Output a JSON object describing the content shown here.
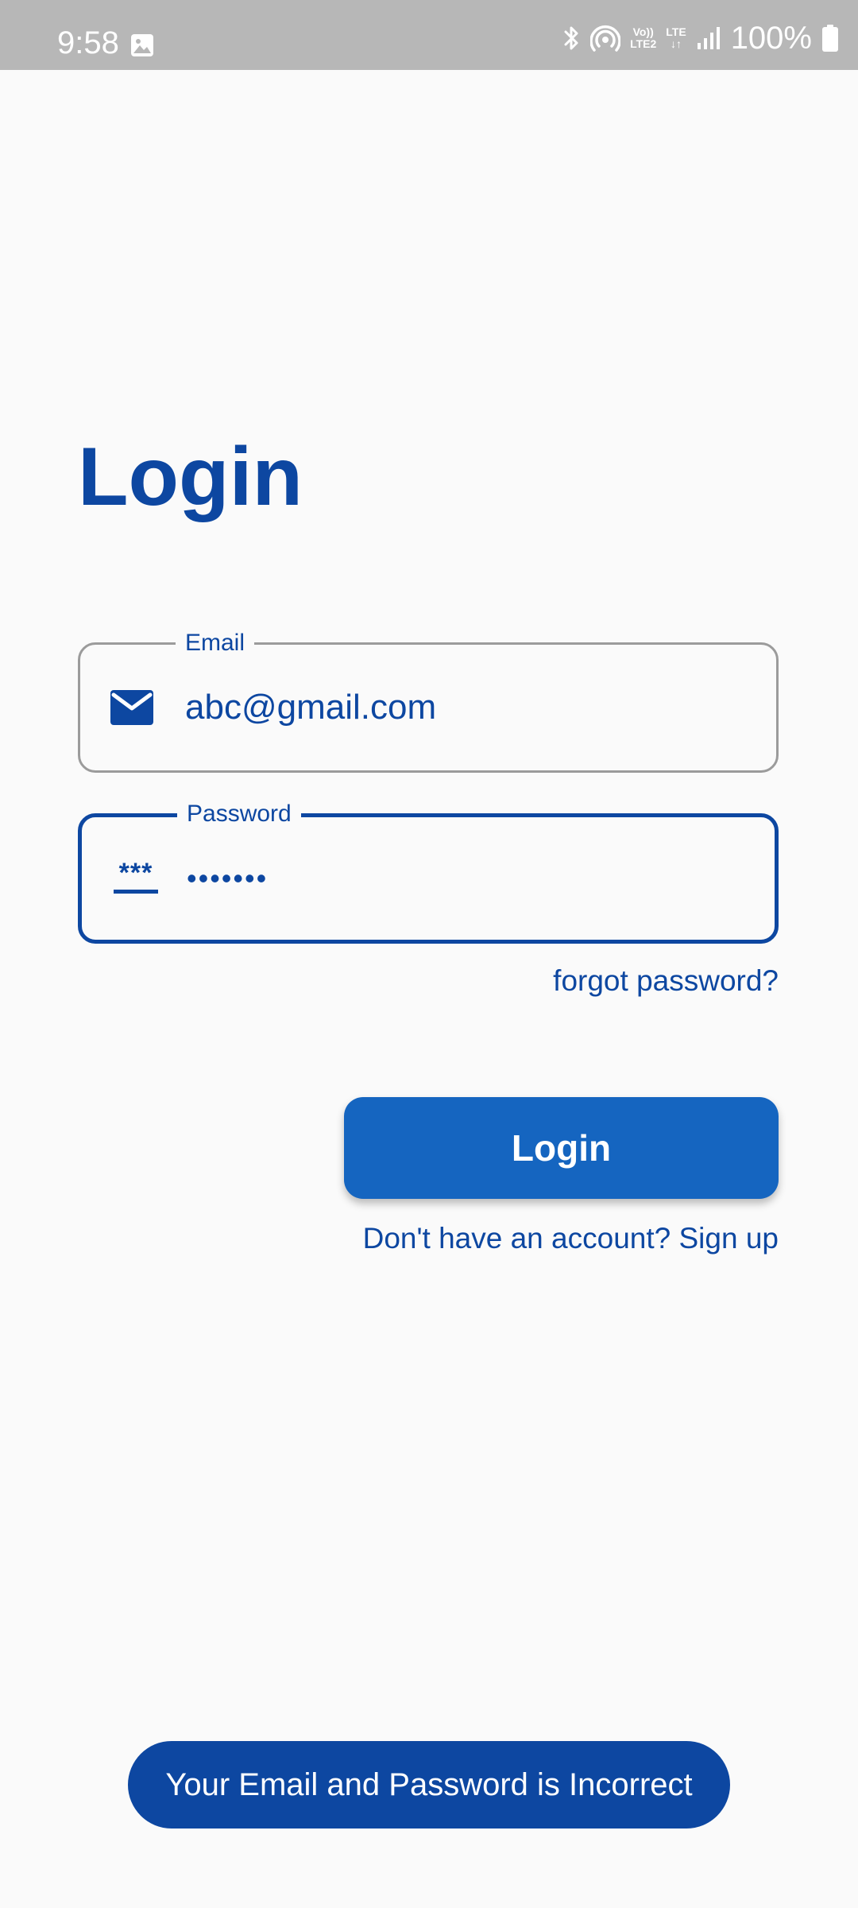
{
  "status_bar": {
    "time": "9:58",
    "volte_top": "Vo))",
    "volte_bottom": "LTE2",
    "lte_label": "LTE",
    "lte_arrows": "↓↑",
    "battery": "100%",
    "icons": [
      "gallery-icon",
      "bluetooth-icon",
      "hotspot-icon",
      "signal-icon",
      "battery-icon"
    ]
  },
  "login": {
    "title": "Login",
    "email": {
      "label": "Email",
      "value": "abc@gmail.com",
      "icon": "mail-icon"
    },
    "password": {
      "label": "Password",
      "value": "•••••••",
      "icon": "password-asterisk-icon"
    },
    "forgot_password": "forgot password?",
    "login_button": "Login",
    "signup_prompt": "Don't have an account? ",
    "signup_link": "Sign up"
  },
  "toast": {
    "message": "Your Email and Password is Incorrect"
  },
  "colors": {
    "primary": "#0d47a1",
    "button": "#1565c0",
    "background": "#fafafa",
    "status_bar": "#b7b7b7",
    "email_border": "#9b9b9b"
  }
}
